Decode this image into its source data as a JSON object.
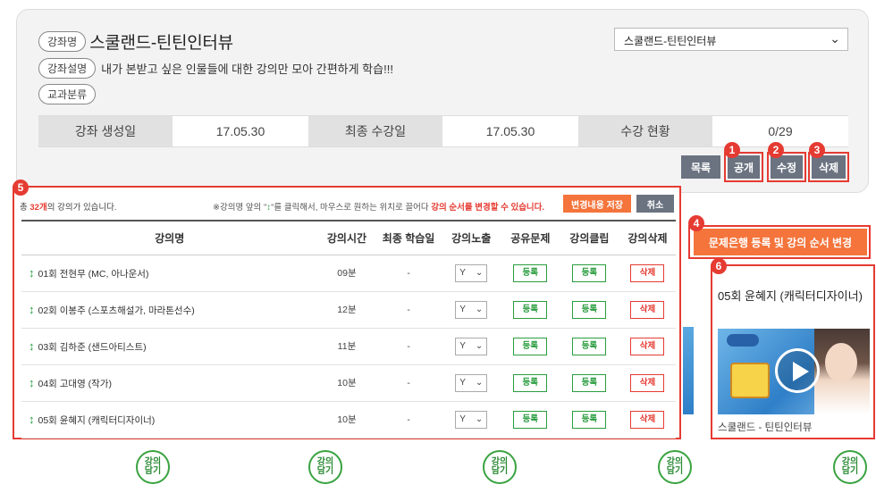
{
  "course": {
    "name_tag": "강좌명",
    "name": "스쿨랜드-틴틴인터뷰",
    "desc_tag": "강좌설명",
    "desc": "내가 본받고 싶은 인물들에 대한 강의만 모아 간편하게 학습!!!",
    "category_tag": "교과분류",
    "select_value": "스쿨랜드-틴틴인터뷰"
  },
  "stats": {
    "created_label": "강좌 생성일",
    "created_value": "17.05.30",
    "last_label": "최종 수강일",
    "last_value": "17.05.30",
    "status_label": "수강 현황",
    "status_value": "0/29"
  },
  "actions": {
    "list": "목록",
    "public": "공개",
    "edit": "수정",
    "delete": "삭제"
  },
  "badges": [
    "1",
    "2",
    "3",
    "4",
    "5",
    "6"
  ],
  "table_panel": {
    "total_prefix": "총 ",
    "total_count": "32개",
    "total_suffix": "의 강의가 있습니다.",
    "hint_prefix": "※강의명 앞의 \"",
    "hint_arrow": "↕",
    "hint_mid": "\"를 클릭해서, 마우스로 원하는 위치로 끌어다 ",
    "hint_red": "강의 순서를 변경할 수 있습니다.",
    "save_label": "변경내용 저장",
    "cancel_label": "취소",
    "headers": [
      "강의명",
      "강의시간",
      "최종 학습일",
      "강의노출",
      "공유문제",
      "강의클립",
      "강의삭제"
    ],
    "rows": [
      {
        "name": "01회 전현무 (MC, 아나운서)",
        "time": "09분",
        "last": "-",
        "expose": "Y",
        "share": "등록",
        "clip": "등록",
        "del": "삭제"
      },
      {
        "name": "02회 이봉주 (스포츠해설가, 마라톤선수)",
        "time": "12분",
        "last": "-",
        "expose": "Y",
        "share": "등록",
        "clip": "등록",
        "del": "삭제"
      },
      {
        "name": "03회 김하준 (샌드아티스트)",
        "time": "11분",
        "last": "-",
        "expose": "Y",
        "share": "등록",
        "clip": "등록",
        "del": "삭제"
      },
      {
        "name": "04회 고대영 (작가)",
        "time": "10분",
        "last": "-",
        "expose": "Y",
        "share": "등록",
        "clip": "등록",
        "del": "삭제"
      },
      {
        "name": "05회 윤혜지 (캐릭터디자이너)",
        "time": "10분",
        "last": "-",
        "expose": "Y",
        "share": "등록",
        "clip": "등록",
        "del": "삭제"
      }
    ]
  },
  "side": {
    "big_button": "문제은행 등록 및 강의 순서 변경",
    "preview_title": "05회 윤혜지 (캐릭터디자이너)",
    "preview_caption": "스쿨랜드 - 틴틴인터뷰"
  },
  "basket_label": "강의담기",
  "colors": {
    "accent_red": "#e53b32",
    "orange": "#f4743b",
    "green": "#2a9d3f",
    "gray_button": "#6b7381"
  }
}
